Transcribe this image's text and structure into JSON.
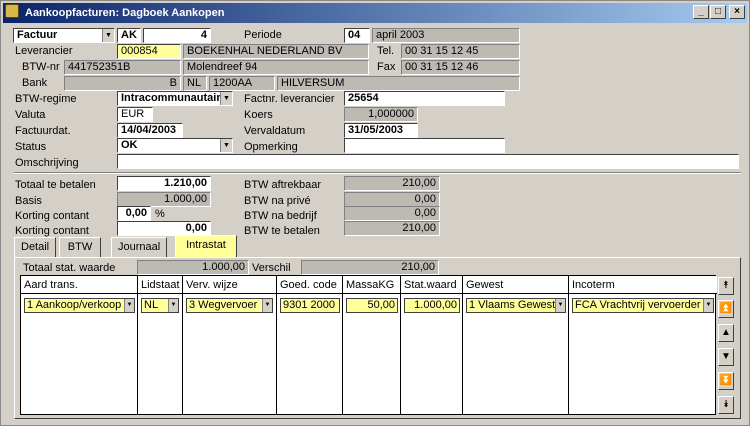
{
  "window": {
    "title": "Aankoopfacturen: Dagboek Aankopen"
  },
  "header": {
    "type_value": "Factuur",
    "journal_code": "AK",
    "number": "4",
    "periode_label": "Periode",
    "periode_num": "04",
    "periode_text": "april 2003",
    "leverancier_label": "Leverancier",
    "leverancier_code": "000854",
    "leverancier_name": "BOEKENHAL NEDERLAND BV",
    "tel_label": "Tel.",
    "tel_value": "00 31 15 12 45",
    "btwnr_label": "BTW-nr",
    "btwnr_value": "441752351B",
    "address_value": "Molendreef 94",
    "fax_label": "Fax",
    "fax_value": "00 31 15 12 46",
    "bank_label": "Bank",
    "bank_value": "B",
    "country_value": "NL",
    "postcode_value": "1200AA",
    "city_value": "HILVERSUM",
    "btwregime_label": "BTW-regime",
    "btwregime_value": "Intracommunautair",
    "factnr_label": "Factnr. leverancier",
    "factnr_value": "25654",
    "valuta_label": "Valuta",
    "valuta_value": "EUR",
    "koers_label": "Koers",
    "koers_value": "1,000000",
    "factuurdat_label": "Factuurdat.",
    "factuurdat_value": "14/04/2003",
    "vervaldatum_label": "Vervaldatum",
    "vervaldatum_value": "31/05/2003",
    "status_label": "Status",
    "status_value": "OK",
    "opmerking_label": "Opmerking",
    "opmerking_value": "",
    "omschrijving_label": "Omschrijving",
    "omschrijving_value": ""
  },
  "totals": {
    "totaal_label": "Totaal te betalen",
    "totaal_value": "1.210,00",
    "basis_label": "Basis",
    "basis_value": "1.000,00",
    "korting1_label": "Korting contant",
    "korting1_value": "0,00",
    "korting1_unit": "%",
    "korting2_label": "Korting contant",
    "korting2_value": "0,00",
    "btw_aftrek_label": "BTW aftrekbaar",
    "btw_aftrek_value": "210,00",
    "btw_prive_label": "BTW na privé",
    "btw_prive_value": "0,00",
    "btw_bedrijf_label": "BTW na bedrijf",
    "btw_bedrijf_value": "0,00",
    "btw_betalen_label": "BTW te betalen",
    "btw_betalen_value": "210,00"
  },
  "tabs": [
    {
      "label": "Detail"
    },
    {
      "label": "BTW"
    },
    {
      "label": "Journaal"
    },
    {
      "label": "Intrastat"
    }
  ],
  "intrastat": {
    "totaal_stat_label": "Totaal stat. waarde",
    "totaal_stat_value": "1.000,00",
    "verschil_label": "Verschil",
    "verschil_value": "210,00",
    "columns": [
      "Aard trans.",
      "Lidstaat",
      "Verv. wijze",
      "Goed. code",
      "MassaKG",
      "Stat.waard",
      "Gewest",
      "Incoterm"
    ],
    "row": {
      "aard": "1 Aankoop/verkoop",
      "lidstaat": "NL",
      "vervoer": "3 Wegvervoer",
      "goedcode": "9301 2000",
      "massa": "50,00",
      "statwaard": "1.000,00",
      "gewest": "1 Vlaams Gewest",
      "incoterm": "FCA Vrachtvrij vervoerder"
    }
  },
  "colors": {
    "title_start": "#0a246a",
    "title_end": "#a6caf0",
    "highlight": "#ffff99",
    "readonly": "#bdbab3"
  },
  "icons": [
    "app-icon",
    "minimize-icon",
    "maximize-icon",
    "close-icon",
    "dropdown-arrow-icon",
    "nav-first-icon",
    "nav-page-up-icon",
    "nav-up-icon",
    "nav-down-icon",
    "nav-page-down-icon",
    "nav-last-icon"
  ]
}
